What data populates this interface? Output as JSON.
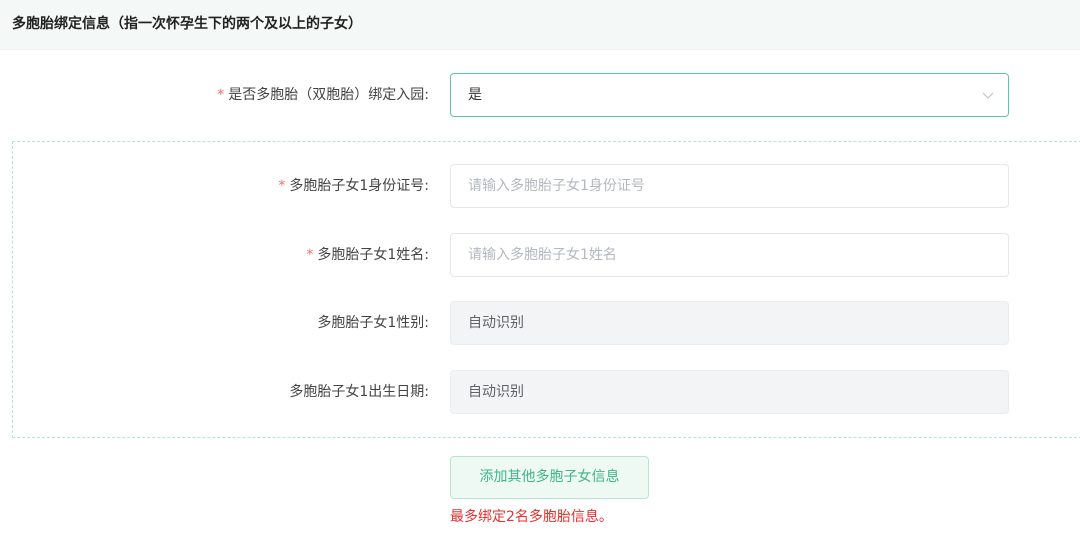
{
  "section": {
    "title": "多胞胎绑定信息（指一次怀孕生下的两个及以上的子女）"
  },
  "form": {
    "required_mark": "*",
    "multi_birth": {
      "label": "是否多胞胎（双胞胎）绑定入园:",
      "value": "是"
    },
    "child1_id": {
      "label": "多胞胎子女1身份证号:",
      "placeholder": "请输入多胞胎子女1身份证号"
    },
    "child1_name": {
      "label": "多胞胎子女1姓名:",
      "placeholder": "请输入多胞胎子女1姓名"
    },
    "child1_gender": {
      "label": "多胞胎子女1性别:",
      "value": "自动识别"
    },
    "child1_birthdate": {
      "label": "多胞胎子女1出生日期:",
      "value": "自动识别"
    }
  },
  "actions": {
    "add_label": "添加其他多胞子女信息"
  },
  "hint": "最多绑定2名多胞胎信息。",
  "colors": {
    "accent": "#3fb687",
    "required": "#f56c6c",
    "hint": "#e5312f"
  },
  "icons": {
    "select_arrow": "chevron-down-icon"
  }
}
